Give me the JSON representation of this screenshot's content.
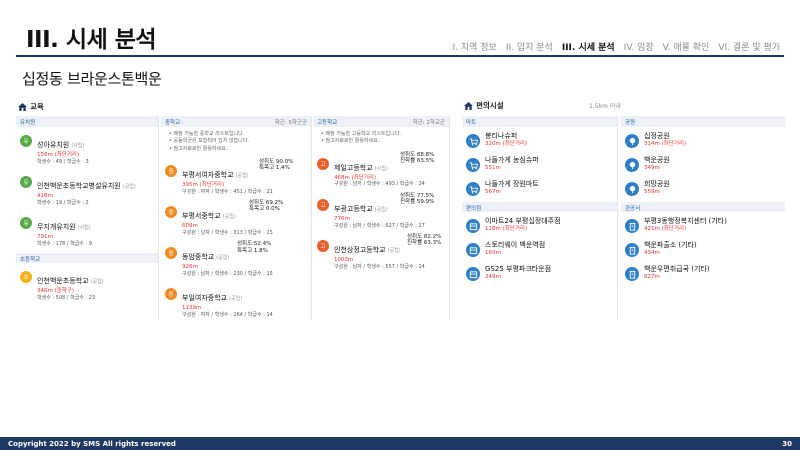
{
  "header": {
    "title": "III. 시세 분석",
    "nav": [
      "I. 지역 정보",
      "II. 입지 분석",
      "III. 시세 분석",
      "IV. 임장",
      "V. 매물 확인",
      "VI. 결론 및 평가"
    ],
    "subtitle": "십정동 브라운스톤백운"
  },
  "education": {
    "heading": "교육",
    "kindergarten": {
      "title": "유치원",
      "items": [
        {
          "badge": "유",
          "name": "성아유치원",
          "type": "(사립)",
          "dist": "156m (최단거리)",
          "meta": "학생수 : 49 / 학급수 : 3"
        },
        {
          "badge": "유",
          "name": "인천백운초등학교병설유치원",
          "type": "(공립)",
          "dist": "418m",
          "meta": "학생수 : 19 / 학급수 : 2"
        },
        {
          "badge": "유",
          "name": "무지개유치원",
          "type": "(사립)",
          "dist": "791m",
          "meta": "학생수 : 178 / 학급수 : 9"
        }
      ]
    },
    "elementary": {
      "title": "초등학교",
      "items": [
        {
          "badge": "초",
          "name": "인천백운초등학교",
          "type": "(공립)",
          "dist": "346m (중학구)",
          "meta": "학생수 : 508 / 학급수 : 23"
        }
      ]
    },
    "middle": {
      "title": "중학교",
      "note": "학군: 5학군군",
      "bullets": [
        "배정 가능한 중학교 리스트입니다.",
        "공동학군은 포함되어 있지 않습니다.",
        "참고자료로만 활용하세요."
      ],
      "items": [
        {
          "badge": "중",
          "name": "부평서여자중학교",
          "type": "(공립)",
          "dist": "395m (최단거리)",
          "meta": "구성원 : 여자 / 학생수 : 451 / 학급수 : 21",
          "rate1": "성취도 90.0%",
          "rate2": "특목고 1.4%"
        },
        {
          "badge": "중",
          "name": "부평서중학교",
          "type": "(공립)",
          "dist": "609m",
          "meta": "구성원 : 남자 / 학생수 : 313 / 학급수 : 15",
          "rate1": "성취도 69.2%",
          "rate2": "특목고 0.0%"
        },
        {
          "badge": "중",
          "name": "동암중학교",
          "type": "(공립)",
          "dist": "926m",
          "meta": "구성원 : 남자 / 학생수 : 230 / 학급수 : 15",
          "rate1": "성취도 52.4%",
          "rate2": "특목고 1.8%"
        },
        {
          "badge": "중",
          "name": "부일여자중학교",
          "type": "(공립)",
          "dist": "1139m",
          "meta": "구성원 : 여자 / 학생수 : 264 / 학급수 : 14",
          "rate1": "",
          "rate2": ""
        }
      ]
    },
    "high": {
      "title": "고등학교",
      "note": "학군: 2학교군",
      "bullets": [
        "배정 가능한 고등학교 리스트입니다.",
        "참고자료로만 활용하세요."
      ],
      "items": [
        {
          "badge": "고",
          "name": "제일고등학교",
          "type": "(사립)",
          "dist": "468m (최단거리)",
          "meta": "구성원 : 남자 / 학생수 : 493 / 학급수 : 24",
          "rate1": "성취도 88.8%",
          "rate2": "진학률 63.5%"
        },
        {
          "badge": "고",
          "name": "부광고등학교",
          "type": "(공립)",
          "dist": "776m",
          "meta": "구성원 : 남자 / 학생수 : 627 / 학급수 : 27",
          "rate1": "성취도 77.5%",
          "rate2": "진학률 59.9%"
        },
        {
          "badge": "고",
          "name": "인천상정고등학교",
          "type": "(공립)",
          "dist": "1003m",
          "meta": "구성원 : 남자 / 학생수 : 557 / 학급수 : 24",
          "rate1": "성취도 82.2%",
          "rate2": "진학률 63.3%"
        }
      ]
    }
  },
  "facilities": {
    "heading": "편의시설",
    "range": "1.5km 이내",
    "mart": {
      "title": "마트",
      "items": [
        {
          "name": "봉티나슈퍼",
          "dist": "320m (최단거리)"
        },
        {
          "name": "나들가게 농심슈퍼",
          "dist": "551m"
        },
        {
          "name": "나들가게 장원마트",
          "dist": "567m"
        }
      ]
    },
    "convenience": {
      "title": "편의점",
      "items": [
        {
          "name": "이마트24 부평십정대주점",
          "dist": "128m (최단거리)"
        },
        {
          "name": "스토리웨이 백운역점",
          "dist": "165m"
        },
        {
          "name": "GS25 부평파크타운점",
          "dist": "249m"
        }
      ]
    },
    "park": {
      "title": "공원",
      "items": [
        {
          "name": "십정공원",
          "dist": "314m (최단거리)"
        },
        {
          "name": "백운공원",
          "dist": "349m"
        },
        {
          "name": "희망공원",
          "dist": "559m"
        }
      ]
    },
    "public": {
      "title": "관공서",
      "items": [
        {
          "name": "부평3동행정복지센터 (기타)",
          "dist": "421m (최단거리)"
        },
        {
          "name": "백운파출소 (기타)",
          "dist": "434m"
        },
        {
          "name": "백운우편취급국 (기타)",
          "dist": "827m"
        }
      ]
    }
  },
  "footer": {
    "copyright": "Copyright 2022 by SMS All rights reserved",
    "page": "30"
  }
}
